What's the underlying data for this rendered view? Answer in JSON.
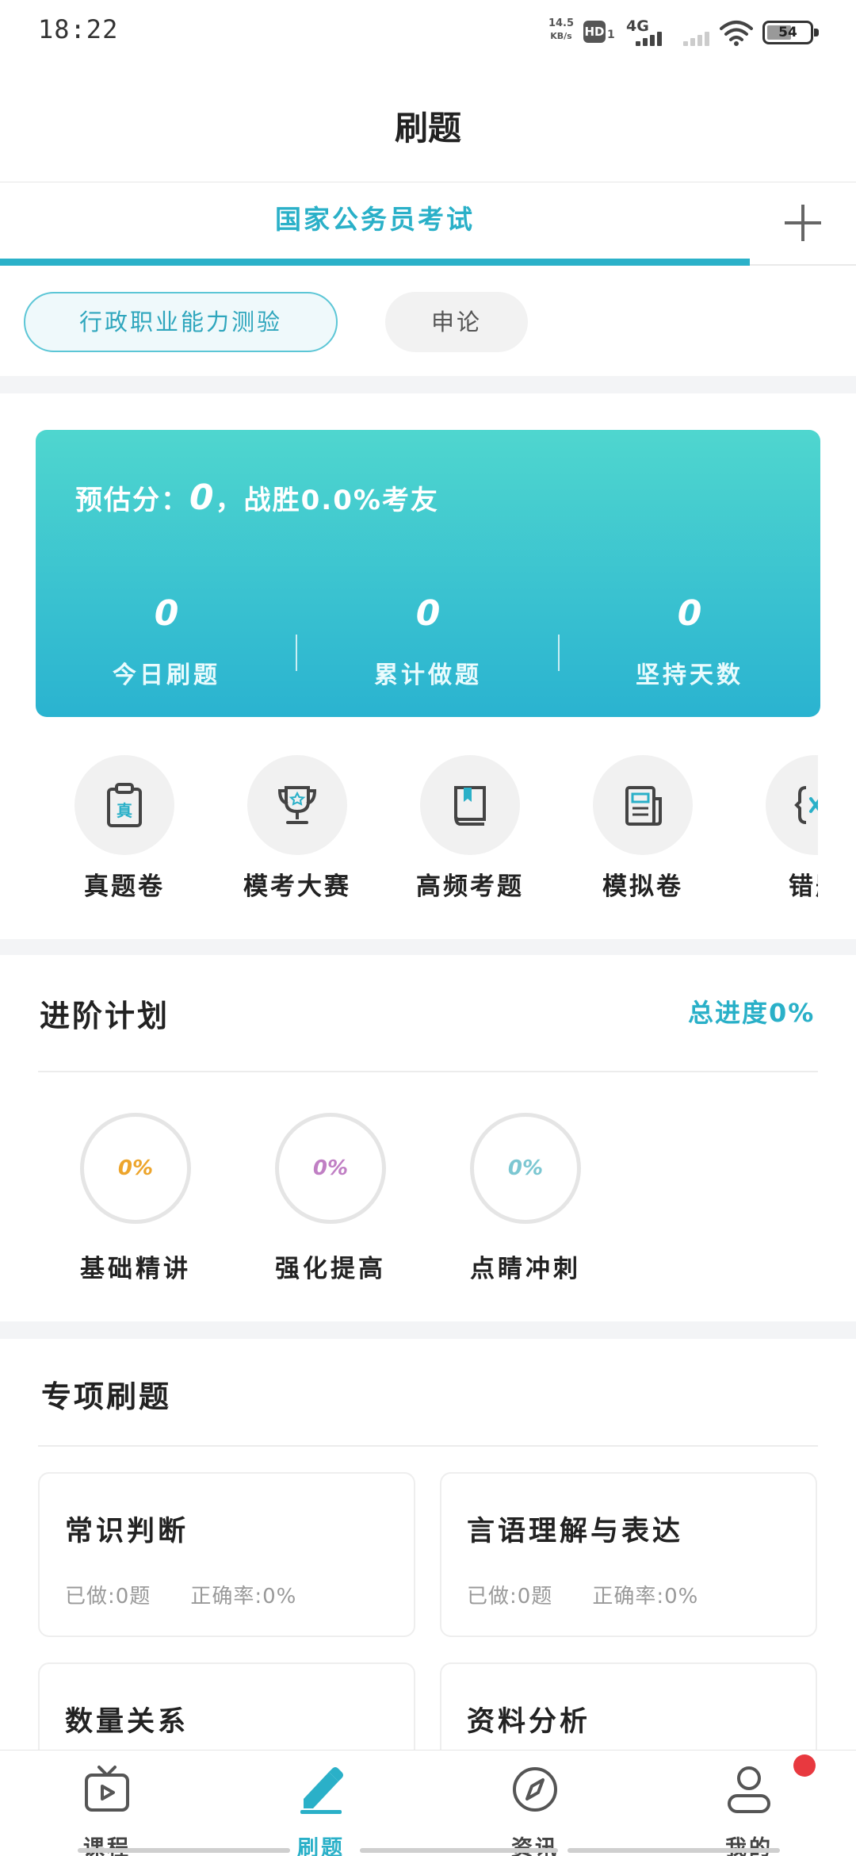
{
  "status_bar": {
    "time": "18:22",
    "net_speed_value": "14.5",
    "net_speed_unit": "KB/s",
    "hd_badge": "HD",
    "hd_sub": "1",
    "network": "4G",
    "battery": "54"
  },
  "header": {
    "title": "刷题"
  },
  "exam_tabs": {
    "active": "国家公务员考试",
    "add_icon": "plus-icon"
  },
  "subjects": [
    "行政职业能力测验",
    "申论"
  ],
  "score_card": {
    "prefix": "预估分：",
    "score": "0",
    "suffix": "，战胜0.0%考友",
    "stats": [
      {
        "value": "0",
        "label": "今日刷题"
      },
      {
        "value": "0",
        "label": "累计做题"
      },
      {
        "value": "0",
        "label": "坚持天数"
      }
    ]
  },
  "quick_entries": [
    {
      "label": "真题卷",
      "icon": "clipboard-icon",
      "glyph": "真"
    },
    {
      "label": "模考大赛",
      "icon": "trophy-icon"
    },
    {
      "label": "高频考题",
      "icon": "book-icon"
    },
    {
      "label": "模拟卷",
      "icon": "newspaper-icon"
    },
    {
      "label": "错题",
      "icon": "wrong-questions-icon"
    }
  ],
  "plan": {
    "title": "进阶计划",
    "total_progress": "总进度0%",
    "stages": [
      {
        "label": "基础精讲",
        "percent": "0%",
        "color": "#eda52c"
      },
      {
        "label": "强化提高",
        "percent": "0%",
        "color": "#c07fc4"
      },
      {
        "label": "点睛冲刺",
        "percent": "0%",
        "color": "#7cc7d2"
      }
    ]
  },
  "practice": {
    "title": "专项刷题",
    "cards": [
      {
        "title": "常识判断",
        "done": "已做:0题",
        "accuracy": "正确率:0%"
      },
      {
        "title": "言语理解与表达",
        "done": "已做:0题",
        "accuracy": "正确率:0%"
      },
      {
        "title": "数量关系"
      },
      {
        "title": "资料分析"
      }
    ]
  },
  "bottom_nav": [
    {
      "label": "课程",
      "icon": "tv-icon"
    },
    {
      "label": "刷题",
      "icon": "pen-icon"
    },
    {
      "label": "资讯",
      "icon": "compass-icon"
    },
    {
      "label": "我的",
      "icon": "person-icon"
    }
  ],
  "colors": {
    "accent": "#2ab0c8",
    "card_top": "#4fd6cf",
    "card_bottom": "#2ab3d0",
    "badge": "#e8393f"
  }
}
